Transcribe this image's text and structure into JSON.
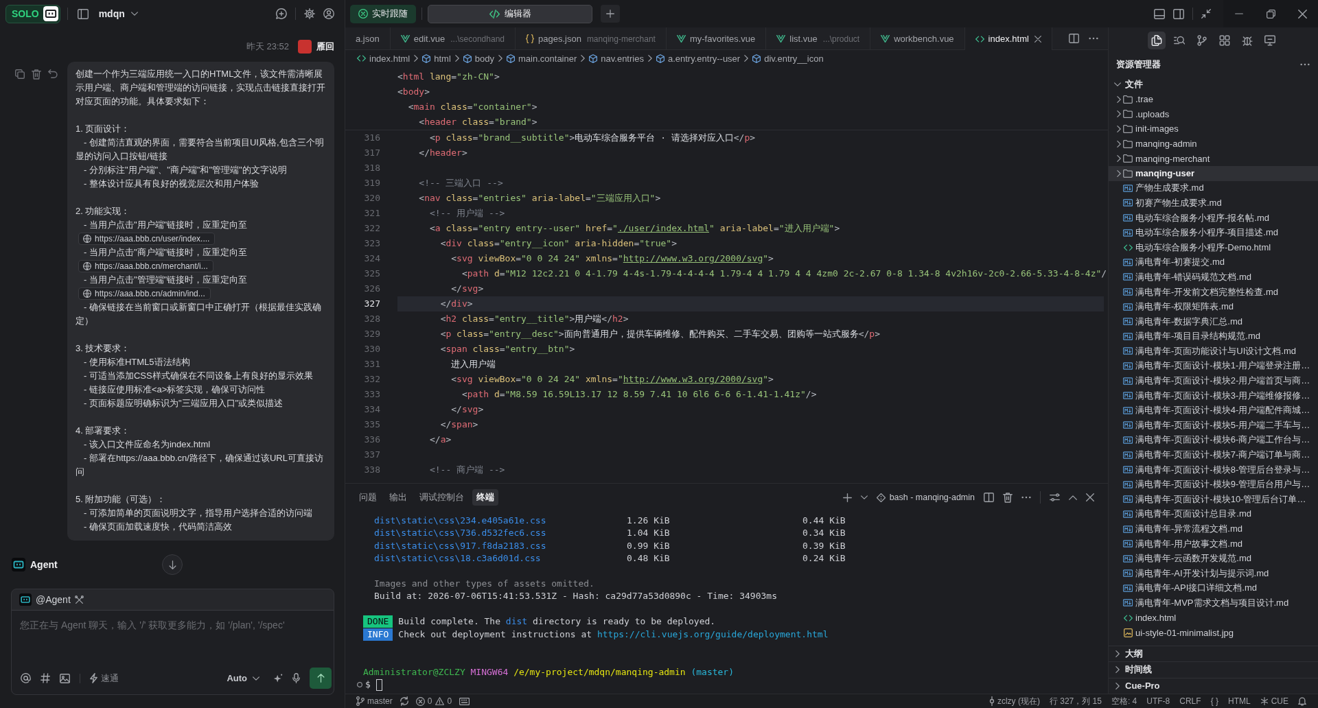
{
  "top_bar": {
    "follow": {
      "label": "实时跟随",
      "on": true
    },
    "view_tabs": [
      {
        "label": "编辑器",
        "selected": true
      }
    ]
  },
  "chat": {
    "app_badge": "SOLO",
    "project": "mdqn",
    "time": "昨天 23:52",
    "author": "雁回",
    "message": [
      [
        {
          "kind": "para",
          "text": "创建一个作为三端应用统一入口的HTML文件，该文件需清晰展示用户端、商户端和管理端的访问链接，实现点击链接直接打开对应页面的功能。具体要求如下："
        }
      ],
      [
        {
          "kind": "para",
          "text": "1. 页面设计："
        },
        {
          "kind": "item",
          "text": "- 创建简洁直观的界面，需要符合当前项目UI风格,包含三个明显的访问入口按钮/链接"
        },
        {
          "kind": "item",
          "text": "- 分别标注\"用户端\"、\"商户端\"和\"管理端\"的文字说明"
        },
        {
          "kind": "item",
          "text": "- 整体设计应具有良好的视觉层次和用户体验"
        }
      ],
      [
        {
          "kind": "para",
          "text": "2. 功能实现："
        },
        {
          "kind": "item",
          "text": "- 当用户点击\"用户端\"链接时，应重定向至"
        },
        {
          "kind": "link",
          "text": "https://aaa.bbb.cn/user/index...."
        },
        {
          "kind": "item",
          "text": "- 当用户点击\"商户端\"链接时，应重定向至"
        },
        {
          "kind": "link",
          "text": "https://aaa.bbb.cn/merchant/i..."
        },
        {
          "kind": "item",
          "text": "- 当用户点击\"管理端\"链接时，应重定向至"
        },
        {
          "kind": "link",
          "text": "https://aaa.bbb.cn/admin/ind..."
        },
        {
          "kind": "item",
          "text": "- 确保链接在当前窗口或新窗口中正确打开（根据最佳实践确定）"
        }
      ],
      [
        {
          "kind": "para",
          "text": "3. 技术要求："
        },
        {
          "kind": "item",
          "text": "- 使用标准HTML5语法结构"
        },
        {
          "kind": "item",
          "text": "- 可适当添加CSS样式确保在不同设备上有良好的显示效果"
        },
        {
          "kind": "item",
          "text": "- 链接应使用标准<a>标签实现，确保可访问性"
        },
        {
          "kind": "item",
          "text": "- 页面标题应明确标识为\"三端应用入口\"或类似描述"
        }
      ],
      [
        {
          "kind": "para",
          "text": "4. 部署要求："
        },
        {
          "kind": "item",
          "text": "- 该入口文件应命名为index.html"
        },
        {
          "kind": "item",
          "text": "- 部署在https://aaa.bbb.cn/路径下，确保通过该URL可直接访问"
        }
      ],
      [
        {
          "kind": "para",
          "text": "5. 附加功能（可选）："
        },
        {
          "kind": "item",
          "text": "- 可添加简单的页面说明文字，指导用户选择合适的访问端"
        },
        {
          "kind": "item",
          "text": "- 确保页面加载速度快，代码简洁高效"
        }
      ]
    ],
    "agent": "Agent",
    "composer": {
      "mention": "@Agent",
      "placeholder": "您正在与 Agent 聊天，输入 '/' 获取更多能力，如 '/plan', '/spec'",
      "mode": "速通",
      "model": "Auto"
    }
  },
  "editor": {
    "tabs": [
      {
        "name": "a.json",
        "selected": false
      },
      {
        "name": "edit.vue",
        "kind": "vue",
        "hint": "...\\secondhand",
        "selected": false
      },
      {
        "name": "pages.json",
        "kind": "json",
        "hint": "manqing-merchant",
        "selected": false
      },
      {
        "name": "my-favorites.vue",
        "kind": "vue",
        "selected": false
      },
      {
        "name": "list.vue",
        "kind": "vue",
        "hint": "...\\product",
        "selected": false
      },
      {
        "name": "workbench.vue",
        "kind": "vue",
        "selected": false
      },
      {
        "name": "index.html",
        "kind": "html",
        "selected": true
      }
    ],
    "breadcrumb": [
      {
        "label": "index.html",
        "kind": "file"
      },
      {
        "label": "html",
        "kind": "element"
      },
      {
        "label": "body",
        "kind": "element"
      },
      {
        "label": "main.container",
        "kind": "element"
      },
      {
        "label": "nav.entries",
        "kind": "element"
      },
      {
        "label": "a.entry.entry--user",
        "kind": "element"
      },
      {
        "label": "div.entry__icon",
        "kind": "element"
      }
    ],
    "sticky_lines": [
      {
        "code": [
          {
            "kind": "punct",
            "text": "<"
          },
          {
            "kind": "tag",
            "text": "html"
          },
          {
            "kind": "attr",
            "text": " lang"
          },
          {
            "kind": "punct",
            "text": "="
          },
          {
            "kind": "string",
            "text": "\"zh-CN\""
          },
          {
            "kind": "punct",
            "text": ">"
          }
        ]
      },
      {
        "code": [
          {
            "kind": "punct",
            "text": "<"
          },
          {
            "kind": "tag",
            "text": "body"
          },
          {
            "kind": "punct",
            "text": ">"
          }
        ]
      },
      {
        "code": [
          {
            "kind": "punct",
            "text": "  <"
          },
          {
            "kind": "tag",
            "text": "main"
          },
          {
            "kind": "attr",
            "text": " class"
          },
          {
            "kind": "punct",
            "text": "="
          },
          {
            "kind": "string",
            "text": "\"container\""
          },
          {
            "kind": "punct",
            "text": ">"
          }
        ]
      },
      {
        "code": [
          {
            "kind": "punct",
            "text": "    <"
          },
          {
            "kind": "tag",
            "text": "header"
          },
          {
            "kind": "attr",
            "text": " class"
          },
          {
            "kind": "punct",
            "text": "="
          },
          {
            "kind": "string",
            "text": "\"brand\""
          },
          {
            "kind": "punct",
            "text": ">"
          }
        ]
      }
    ],
    "lines": [
      {
        "number": "316",
        "current": false,
        "code": [
          {
            "kind": "punct",
            "text": "      <"
          },
          {
            "kind": "tag",
            "text": "p"
          },
          {
            "kind": "attr",
            "text": " class"
          },
          {
            "kind": "punct",
            "text": "="
          },
          {
            "kind": "string",
            "text": "\"brand__subtitle\""
          },
          {
            "kind": "punct",
            "text": ">"
          },
          {
            "kind": "text",
            "text": "电动车综合服务平台 · 请选择对应入口"
          },
          {
            "kind": "punct",
            "text": "</"
          },
          {
            "kind": "tag",
            "text": "p"
          },
          {
            "kind": "punct",
            "text": ">"
          }
        ]
      },
      {
        "number": "317",
        "current": false,
        "code": [
          {
            "kind": "punct",
            "text": "    </"
          },
          {
            "kind": "tag",
            "text": "header"
          },
          {
            "kind": "punct",
            "text": ">"
          }
        ]
      },
      {
        "number": "318",
        "current": false
      },
      {
        "number": "319",
        "current": false,
        "code": [
          {
            "kind": "comment",
            "text": "    <!-- 三端入口 -->"
          }
        ]
      },
      {
        "number": "320",
        "current": false,
        "code": [
          {
            "kind": "punct",
            "text": "    <"
          },
          {
            "kind": "tag",
            "text": "nav"
          },
          {
            "kind": "attr",
            "text": " class"
          },
          {
            "kind": "punct",
            "text": "="
          },
          {
            "kind": "string",
            "text": "\"entries\""
          },
          {
            "kind": "attr",
            "text": " aria-label"
          },
          {
            "kind": "punct",
            "text": "="
          },
          {
            "kind": "string",
            "text": "\"三端应用入口\""
          },
          {
            "kind": "punct",
            "text": ">"
          }
        ]
      },
      {
        "number": "321",
        "current": false,
        "code": [
          {
            "kind": "comment",
            "text": "      <!-- 用户端 -->"
          }
        ]
      },
      {
        "number": "322",
        "current": false,
        "code": [
          {
            "kind": "punct",
            "text": "      <"
          },
          {
            "kind": "tag",
            "text": "a"
          },
          {
            "kind": "attr",
            "text": " class"
          },
          {
            "kind": "punct",
            "text": "="
          },
          {
            "kind": "string",
            "text": "\"entry entry--user\""
          },
          {
            "kind": "attr",
            "text": " href"
          },
          {
            "kind": "punct",
            "text": "="
          },
          {
            "kind": "string",
            "text": "\""
          },
          {
            "kind": "link",
            "text": "./user/index.html"
          },
          {
            "kind": "string",
            "text": "\""
          },
          {
            "kind": "attr",
            "text": " aria-label"
          },
          {
            "kind": "punct",
            "text": "="
          },
          {
            "kind": "string",
            "text": "\"进入用户端\""
          },
          {
            "kind": "punct",
            "text": ">"
          }
        ]
      },
      {
        "number": "323",
        "current": false,
        "code": [
          {
            "kind": "punct",
            "text": "        <"
          },
          {
            "kind": "tag",
            "text": "div"
          },
          {
            "kind": "attr",
            "text": " class"
          },
          {
            "kind": "punct",
            "text": "="
          },
          {
            "kind": "string",
            "text": "\"entry__icon\""
          },
          {
            "kind": "attr",
            "text": " aria-hidden"
          },
          {
            "kind": "punct",
            "text": "="
          },
          {
            "kind": "string",
            "text": "\"true\""
          },
          {
            "kind": "punct",
            "text": ">"
          }
        ]
      },
      {
        "number": "324",
        "current": false,
        "code": [
          {
            "kind": "punct",
            "text": "          <"
          },
          {
            "kind": "tag",
            "text": "svg"
          },
          {
            "kind": "attr",
            "text": " viewBox"
          },
          {
            "kind": "punct",
            "text": "="
          },
          {
            "kind": "string",
            "text": "\"0 0 24 24\""
          },
          {
            "kind": "attr",
            "text": " xmlns"
          },
          {
            "kind": "punct",
            "text": "="
          },
          {
            "kind": "string",
            "text": "\""
          },
          {
            "kind": "link",
            "text": "http://www.w3.org/2000/svg"
          },
          {
            "kind": "string",
            "text": "\""
          },
          {
            "kind": "punct",
            "text": ">"
          }
        ]
      },
      {
        "number": "325",
        "current": false,
        "code": [
          {
            "kind": "punct",
            "text": "            <"
          },
          {
            "kind": "tag",
            "text": "path"
          },
          {
            "kind": "attr",
            "text": " d"
          },
          {
            "kind": "punct",
            "text": "="
          },
          {
            "kind": "string",
            "text": "\"M12 12c2.21 0 4-1.79 4-4s-1.79-4-4-4-4 1.79-4 4 1.79 4 4 4zm0 2c-2.67 0-8 1.34-8 4v2h16v-2c0-2.66-5.33-4-8-4z\""
          },
          {
            "kind": "punct",
            "text": "/"
          }
        ]
      },
      {
        "number": "326",
        "current": false,
        "code": [
          {
            "kind": "punct",
            "text": "          </"
          },
          {
            "kind": "tag",
            "text": "svg"
          },
          {
            "kind": "punct",
            "text": ">"
          }
        ]
      },
      {
        "number": "327",
        "current": true,
        "code": [
          {
            "kind": "punct",
            "text": "        </"
          },
          {
            "kind": "tag",
            "text": "div"
          },
          {
            "kind": "punct",
            "text": ">"
          }
        ]
      },
      {
        "number": "328",
        "current": false,
        "code": [
          {
            "kind": "punct",
            "text": "        <"
          },
          {
            "kind": "tag",
            "text": "h2"
          },
          {
            "kind": "attr",
            "text": " class"
          },
          {
            "kind": "punct",
            "text": "="
          },
          {
            "kind": "string",
            "text": "\"entry__title\""
          },
          {
            "kind": "punct",
            "text": ">"
          },
          {
            "kind": "text",
            "text": "用户端"
          },
          {
            "kind": "punct",
            "text": "</"
          },
          {
            "kind": "tag",
            "text": "h2"
          },
          {
            "kind": "punct",
            "text": ">"
          }
        ]
      },
      {
        "number": "329",
        "current": false,
        "code": [
          {
            "kind": "punct",
            "text": "        <"
          },
          {
            "kind": "tag",
            "text": "p"
          },
          {
            "kind": "attr",
            "text": " class"
          },
          {
            "kind": "punct",
            "text": "="
          },
          {
            "kind": "string",
            "text": "\"entry__desc\""
          },
          {
            "kind": "punct",
            "text": ">"
          },
          {
            "kind": "text",
            "text": "面向普通用户，提供车辆维修、配件购买、二手车交易、团购等一站式服务"
          },
          {
            "kind": "punct",
            "text": "</"
          },
          {
            "kind": "tag",
            "text": "p"
          },
          {
            "kind": "punct",
            "text": ">"
          }
        ]
      },
      {
        "number": "330",
        "current": false,
        "code": [
          {
            "kind": "punct",
            "text": "        <"
          },
          {
            "kind": "tag",
            "text": "span"
          },
          {
            "kind": "attr",
            "text": " class"
          },
          {
            "kind": "punct",
            "text": "="
          },
          {
            "kind": "string",
            "text": "\"entry__btn\""
          },
          {
            "kind": "punct",
            "text": ">"
          }
        ]
      },
      {
        "number": "331",
        "current": false,
        "code": [
          {
            "kind": "text",
            "text": "          进入用户端"
          }
        ]
      },
      {
        "number": "332",
        "current": false,
        "code": [
          {
            "kind": "punct",
            "text": "          <"
          },
          {
            "kind": "tag",
            "text": "svg"
          },
          {
            "kind": "attr",
            "text": " viewBox"
          },
          {
            "kind": "punct",
            "text": "="
          },
          {
            "kind": "string",
            "text": "\"0 0 24 24\""
          },
          {
            "kind": "attr",
            "text": " xmlns"
          },
          {
            "kind": "punct",
            "text": "="
          },
          {
            "kind": "string",
            "text": "\""
          },
          {
            "kind": "link",
            "text": "http://www.w3.org/2000/svg"
          },
          {
            "kind": "string",
            "text": "\""
          },
          {
            "kind": "punct",
            "text": ">"
          }
        ]
      },
      {
        "number": "333",
        "current": false,
        "code": [
          {
            "kind": "punct",
            "text": "            <"
          },
          {
            "kind": "tag",
            "text": "path"
          },
          {
            "kind": "attr",
            "text": " d"
          },
          {
            "kind": "punct",
            "text": "="
          },
          {
            "kind": "string",
            "text": "\"M8.59 16.59L13.17 12 8.59 7.41 10 6l6 6-6 6-1.41-1.41z\""
          },
          {
            "kind": "punct",
            "text": "/>"
          }
        ]
      },
      {
        "number": "334",
        "current": false,
        "code": [
          {
            "kind": "punct",
            "text": "          </"
          },
          {
            "kind": "tag",
            "text": "svg"
          },
          {
            "kind": "punct",
            "text": ">"
          }
        ]
      },
      {
        "number": "335",
        "current": false,
        "code": [
          {
            "kind": "punct",
            "text": "        </"
          },
          {
            "kind": "tag",
            "text": "span"
          },
          {
            "kind": "punct",
            "text": ">"
          }
        ]
      },
      {
        "number": "336",
        "current": false,
        "code": [
          {
            "kind": "punct",
            "text": "      </"
          },
          {
            "kind": "tag",
            "text": "a"
          },
          {
            "kind": "punct",
            "text": ">"
          }
        ]
      },
      {
        "number": "337",
        "current": false
      },
      {
        "number": "338",
        "current": false,
        "code": [
          {
            "kind": "comment",
            "text": "      <!-- 商户端 -->"
          }
        ]
      }
    ]
  },
  "panel": {
    "tabs": [
      {
        "label": "问题",
        "selected": false
      },
      {
        "label": "输出",
        "selected": false
      },
      {
        "label": "调试控制台",
        "selected": false
      },
      {
        "label": "终端",
        "selected": true
      }
    ],
    "shell": "bash - manqing-admin",
    "terminal": [
      {
        "kind": "asset",
        "file": "dist\\static\\css\\234.e405a61e.css",
        "size": "1.26 KiB",
        "gzip": "0.44 KiB"
      },
      {
        "kind": "asset",
        "file": "dist\\static\\css\\736.d532fec6.css",
        "size": "1.04 KiB",
        "gzip": "0.34 KiB"
      },
      {
        "kind": "asset",
        "file": "dist\\static\\css\\917.f8da2183.css",
        "size": "0.99 KiB",
        "gzip": "0.39 KiB"
      },
      {
        "kind": "asset",
        "file": "dist\\static\\css\\18.c3a6d01d.css",
        "size": "0.48 KiB",
        "gzip": "0.24 KiB"
      },
      {
        "kind": "gap"
      },
      {
        "kind": "note",
        "text": "Images and other types of assets omitted."
      },
      {
        "kind": "plain",
        "text": "Build at: 2026-07-06T15:41:53.531Z - Hash: ca29d77a53d0890c - Time: 34903ms"
      },
      {
        "kind": "gap"
      },
      {
        "kind": "status",
        "badge": "DONE",
        "color": "#16c47f",
        "parts": [
          {
            "kind": "text",
            "text": "Build complete. The "
          },
          {
            "kind": "keyword",
            "text": "dist"
          },
          {
            "kind": "text",
            "text": " directory is ready to be deployed."
          }
        ]
      },
      {
        "kind": "status",
        "badge": "INFO",
        "color": "#2a78d1",
        "parts": [
          {
            "kind": "text",
            "text": "Check out deployment instructions at "
          },
          {
            "kind": "link",
            "text": "https://cli.vuejs.org/guide/deployment.html"
          }
        ]
      },
      {
        "kind": "gap"
      },
      {
        "kind": "gap"
      },
      {
        "kind": "prompt",
        "parts": [
          {
            "kind": "user",
            "text": "Administrator@ZCLZY"
          },
          {
            "kind": "system",
            "text": "MINGW64"
          },
          {
            "kind": "path",
            "text": "/e/my-project/mdqn/manqing-admin"
          },
          {
            "kind": "branch",
            "text": "(master)"
          }
        ]
      },
      {
        "kind": "input",
        "symbol": "$"
      }
    ]
  },
  "explorer": {
    "activity": [
      {
        "kind": "files",
        "selected": true
      },
      {
        "kind": "search",
        "selected": false
      },
      {
        "kind": "git",
        "selected": false
      },
      {
        "kind": "extensions",
        "selected": false
      },
      {
        "kind": "debug",
        "selected": false
      },
      {
        "kind": "remote",
        "selected": false
      }
    ],
    "title": "资源管理器",
    "sections": [
      {
        "label": "文件",
        "expanded": true,
        "children": [
          {
            "name": ".trae",
            "kind": "folder",
            "expanded": false,
            "selected": false
          },
          {
            "name": ".uploads",
            "kind": "folder",
            "expanded": false,
            "selected": false
          },
          {
            "name": "init-images",
            "kind": "folder",
            "expanded": false,
            "selected": false
          },
          {
            "name": "manqing-admin",
            "kind": "folder",
            "expanded": false,
            "selected": false
          },
          {
            "name": "manqing-merchant",
            "kind": "folder",
            "expanded": false,
            "selected": false
          },
          {
            "name": "manqing-user",
            "kind": "folder",
            "expanded": false,
            "selected": true
          },
          {
            "name": "产物生成要求.md",
            "kind": "md",
            "selected": false
          },
          {
            "name": "初赛产物生成要求.md",
            "kind": "md",
            "selected": false
          },
          {
            "name": "电动车综合服务小程序-报名帖.md",
            "kind": "md",
            "selected": false
          },
          {
            "name": "电动车综合服务小程序-项目描述.md",
            "kind": "md",
            "selected": false
          },
          {
            "name": "电动车综合服务小程序-Demo.html",
            "kind": "html",
            "selected": false
          },
          {
            "name": "满电青年-初赛提交.md",
            "kind": "md",
            "selected": false
          },
          {
            "name": "满电青年-错误码规范文档.md",
            "kind": "md",
            "selected": false
          },
          {
            "name": "满电青年-开发前文档完整性检查.md",
            "kind": "md",
            "selected": false
          },
          {
            "name": "满电青年-权限矩阵表.md",
            "kind": "md",
            "selected": false
          },
          {
            "name": "满电青年-数据字典汇总.md",
            "kind": "md",
            "selected": false
          },
          {
            "name": "满电青年-项目目录结构规范.md",
            "kind": "md",
            "selected": false
          },
          {
            "name": "满电青年-页面功能设计与UI设计文档.md",
            "kind": "md",
            "selected": false
          },
          {
            "name": "满电青年-页面设计-模块1-用户端登录注册…",
            "kind": "md",
            "selected": false
          },
          {
            "name": "满电青年-页面设计-模块2-用户端首页与商…",
            "kind": "md",
            "selected": false
          },
          {
            "name": "满电青年-页面设计-模块3-用户端维修报修…",
            "kind": "md",
            "selected": false
          },
          {
            "name": "满电青年-页面设计-模块4-用户端配件商城…",
            "kind": "md",
            "selected": false
          },
          {
            "name": "满电青年-页面设计-模块5-用户端二手车与…",
            "kind": "md",
            "selected": false
          },
          {
            "name": "满电青年-页面设计-模块6-商户端工作台与…",
            "kind": "md",
            "selected": false
          },
          {
            "name": "满电青年-页面设计-模块7-商户端订单与商…",
            "kind": "md",
            "selected": false
          },
          {
            "name": "满电青年-页面设计-模块8-管理后台登录与…",
            "kind": "md",
            "selected": false
          },
          {
            "name": "满电青年-页面设计-模块9-管理后台用户与…",
            "kind": "md",
            "selected": false
          },
          {
            "name": "满电青年-页面设计-模块10-管理后台订单…",
            "kind": "md",
            "selected": false
          },
          {
            "name": "满电青年-页面设计总目录.md",
            "kind": "md",
            "selected": false
          },
          {
            "name": "满电青年-异常流程文档.md",
            "kind": "md",
            "selected": false
          },
          {
            "name": "满电青年-用户故事文档.md",
            "kind": "md",
            "selected": false
          },
          {
            "name": "满电青年-云函数开发规范.md",
            "kind": "md",
            "selected": false
          },
          {
            "name": "满电青年-AI开发计划与提示词.md",
            "kind": "md",
            "selected": false
          },
          {
            "name": "满电青年-API接口详细文档.md",
            "kind": "md",
            "selected": false
          },
          {
            "name": "满电青年-MVP需求文档与项目设计.md",
            "kind": "md",
            "selected": false
          },
          {
            "name": "index.html",
            "kind": "html",
            "selected": false
          },
          {
            "name": "ui-style-01-minimalist.jpg",
            "kind": "image",
            "selected": false
          }
        ]
      },
      {
        "label": "大纲",
        "expanded": false
      },
      {
        "label": "时间线",
        "expanded": false
      },
      {
        "label": "Cue-Pro",
        "expanded": false
      }
    ]
  },
  "status_bar": {
    "branch": "master",
    "errors": "0",
    "warnings": "0",
    "author": "zclzy (现在)",
    "cursor": "行 327，列 15",
    "indent": "空格: 4",
    "encoding": "UTF-8",
    "eol": "CRLF",
    "braces": "{ }",
    "language": "HTML",
    "extension": "CUE"
  }
}
